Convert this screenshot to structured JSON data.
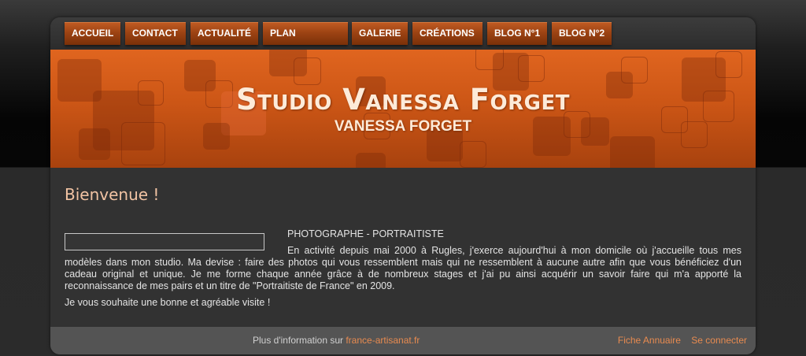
{
  "nav": {
    "items": [
      {
        "label": "ACCUEIL"
      },
      {
        "label": "CONTACT"
      },
      {
        "label": "ACTUALITÉ"
      },
      {
        "label": "PLAN"
      },
      {
        "label": "GALERIE"
      },
      {
        "label": "CRÉATIONS"
      },
      {
        "label": "BLOG N°1"
      },
      {
        "label": "BLOG N°2"
      }
    ]
  },
  "banner": {
    "title": "Studio Vanessa Forget",
    "subtitle": "VANESSA FORGET"
  },
  "main": {
    "welcome": "Bienvenue !",
    "subtitle": "PHOTOGRAPHE - PORTRAITISTE",
    "paragraph": "En activité depuis mai 2000 à Rugles, j'exerce aujourd'hui à mon domicile où j'accueille tous mes modèles dans mon studio. Ma devise : faire des photos qui vous ressemblent mais qui ne ressemblent à aucune autre afin que vous bénéficiez d'un cadeau original et unique. Je me forme chaque année grâce à de nombreux stages et j'ai pu ainsi acquérir un savoir faire qui m'a apporté la reconnaissance de mes pairs et un titre de \"Portraitiste de France\" en 2009.",
    "closing": "Je vous souhaite une bonne et agréable visite !"
  },
  "footer": {
    "info_text": "Plus d'information sur ",
    "info_link": "france-artisanat.fr",
    "link_annuaire": "Fiche Annuaire",
    "link_connect": "Se connecter"
  },
  "colors": {
    "accent": "#cc5616",
    "link": "#e88b50",
    "heading": "#f1c3a3"
  }
}
